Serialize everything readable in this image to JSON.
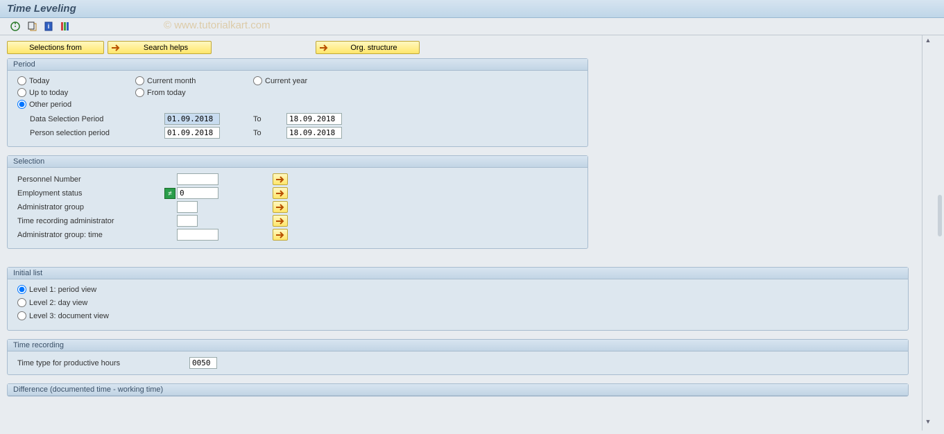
{
  "title": "Time Leveling",
  "watermark": "© www.tutorialkart.com",
  "toolbar": {
    "selections_from": "Selections from",
    "search_helps": "Search helps",
    "org_structure": "Org. structure"
  },
  "period": {
    "legend": "Period",
    "today": "Today",
    "current_month": "Current month",
    "current_year": "Current year",
    "up_to_today": "Up to today",
    "from_today": "From today",
    "other_period": "Other period",
    "data_selection_label": "Data Selection Period",
    "person_selection_label": "Person selection period",
    "to_label": "To",
    "data_from": "01.09.2018",
    "data_to": "18.09.2018",
    "person_from": "01.09.2018",
    "person_to": "18.09.2018"
  },
  "selection": {
    "legend": "Selection",
    "personnel_number": "Personnel Number",
    "employment_status": "Employment status",
    "employment_status_val": "0",
    "admin_group": "Administrator group",
    "time_rec_admin": "Time recording administrator",
    "admin_group_time": "Administrator group: time"
  },
  "initial_list": {
    "legend": "Initial list",
    "level1": "Level 1: period view",
    "level2": "Level 2: day view",
    "level3": "Level 3: document view"
  },
  "time_recording": {
    "legend": "Time recording",
    "type_label": "Time type for productive hours",
    "type_val": "0050"
  },
  "difference": {
    "legend": "Difference (documented time - working time)"
  }
}
